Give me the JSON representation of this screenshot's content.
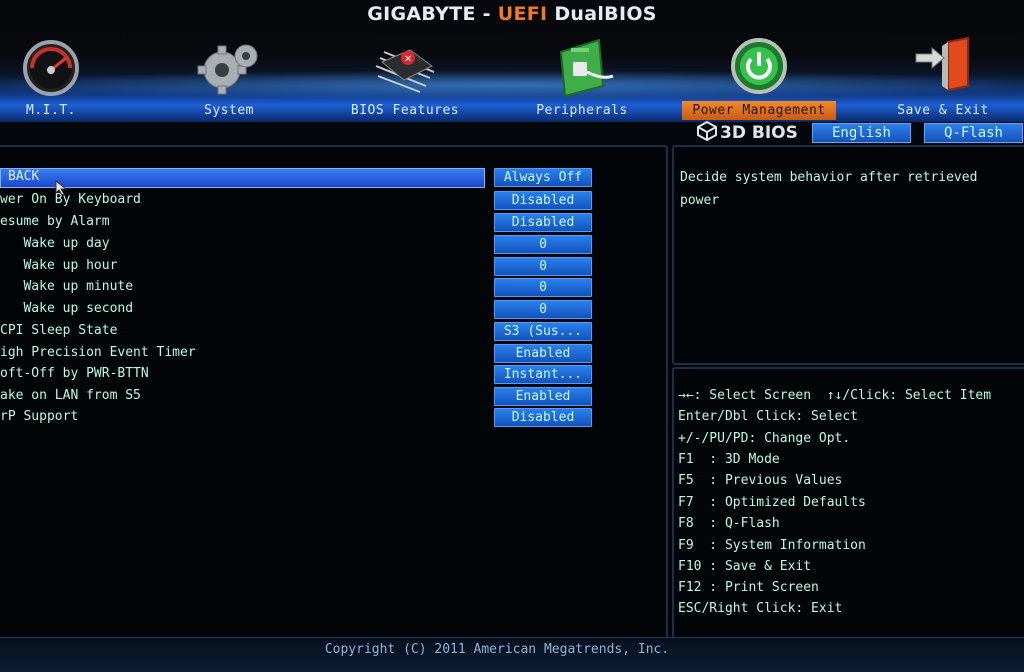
{
  "header": {
    "brand": "GIGABYTE",
    "sep": " - ",
    "uefi": "UEFI",
    "dual": " DualBIOS"
  },
  "tabs": [
    {
      "label": "M.I.T.",
      "icon": "speedometer-icon",
      "active": false
    },
    {
      "label": "System",
      "icon": "gear-icon",
      "active": false
    },
    {
      "label": "BIOS Features",
      "icon": "chip-icon",
      "active": false
    },
    {
      "label": "Peripherals",
      "icon": "circuit-board-icon",
      "active": false
    },
    {
      "label": "Power Management",
      "icon": "power-button-icon",
      "active": true
    },
    {
      "label": "Save & Exit",
      "icon": "exit-door-icon",
      "active": false
    }
  ],
  "subbar": {
    "logo": "3D BIOS",
    "language": "English",
    "qflash": "Q-Flash"
  },
  "items": [
    {
      "label": "BACK",
      "value": "Always Off",
      "selected": true
    },
    {
      "label": "wer On By Keyboard",
      "value": "Disabled"
    },
    {
      "label": "esume by Alarm",
      "value": "Disabled"
    },
    {
      "label": "   Wake up day",
      "value": "0"
    },
    {
      "label": "   Wake up hour",
      "value": "0"
    },
    {
      "label": "   Wake up minute",
      "value": "0"
    },
    {
      "label": "   Wake up second",
      "value": "0"
    },
    {
      "label": "CPI Sleep State",
      "value": "S3 (Sus..."
    },
    {
      "label": "igh Precision Event Timer",
      "value": "Enabled"
    },
    {
      "label": "oft-Off by PWR-BTTN",
      "value": "Instant..."
    },
    {
      "label": "ake on LAN from S5",
      "value": "Enabled"
    },
    {
      "label": "rP Support",
      "value": "Disabled"
    }
  ],
  "help": {
    "line1": "Decide system behavior after retrieved",
    "line2": "power"
  },
  "keys": [
    "→←: Select Screen  ↑↓/Click: Select Item",
    "Enter/Dbl Click: Select",
    "+/-/PU/PD: Change Opt.",
    "F1  : 3D Mode",
    "F5  : Previous Values",
    "F7  : Optimized Defaults",
    "F8  : Q-Flash",
    "F9  : System Information",
    "F10 : Save & Exit",
    "F12 : Print Screen",
    "ESC/Right Click: Exit"
  ],
  "footer": {
    "copyright": "Copyright (C) 2011 American Megatrends, Inc."
  },
  "colors": {
    "accent_blue": "#1d5fd6",
    "active_tab": "#f28a30",
    "text_green": "#b6fbe6"
  }
}
